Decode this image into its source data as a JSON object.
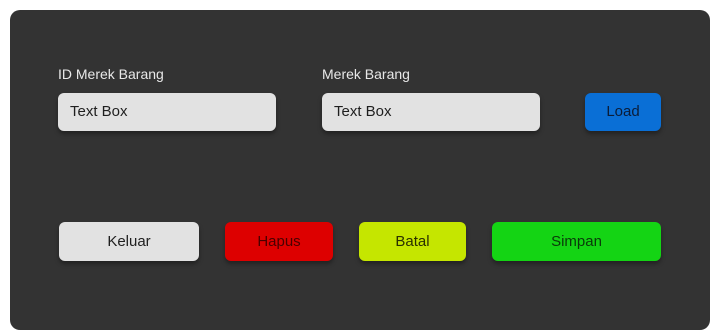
{
  "form": {
    "id_label": "ID Merek Barang",
    "id_placeholder": "Text Box",
    "name_label": "Merek Barang",
    "name_placeholder": "Text Box"
  },
  "buttons": {
    "load": "Load",
    "keluar": "Keluar",
    "hapus": "Hapus",
    "batal": "Batal",
    "simpan": "Simpan"
  },
  "colors": {
    "panel": "#333333",
    "textbox": "#e2e2e2",
    "load": "#0a6fd6",
    "keluar": "#e2e2e2",
    "hapus": "#dd0000",
    "batal": "#c5e600",
    "simpan": "#14d414"
  }
}
